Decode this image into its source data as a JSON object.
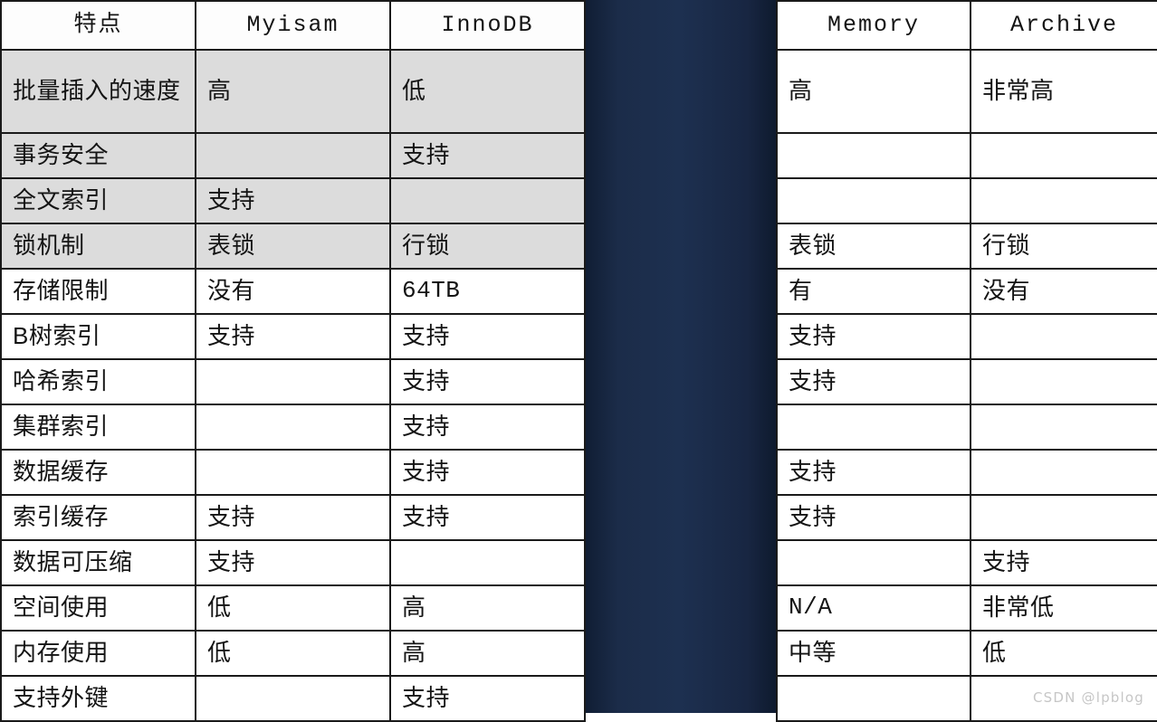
{
  "table_left": {
    "headers": [
      "特点",
      "Myisam",
      "InnoDB"
    ],
    "rows": [
      {
        "feature": "批量插入的速度",
        "myisam": "高",
        "innodb": "低"
      },
      {
        "feature": "事务安全",
        "myisam": "",
        "innodb": "支持"
      },
      {
        "feature": "全文索引",
        "myisam": "支持",
        "innodb": ""
      },
      {
        "feature": "锁机制",
        "myisam": "表锁",
        "innodb": "行锁"
      },
      {
        "feature": "存储限制",
        "myisam": "没有",
        "innodb": "64TB"
      },
      {
        "feature": "B树索引",
        "myisam": "支持",
        "innodb": "支持"
      },
      {
        "feature": "哈希索引",
        "myisam": "",
        "innodb": "支持"
      },
      {
        "feature": "集群索引",
        "myisam": "",
        "innodb": "支持"
      },
      {
        "feature": "数据缓存",
        "myisam": "",
        "innodb": "支持"
      },
      {
        "feature": "索引缓存",
        "myisam": "支持",
        "innodb": "支持"
      },
      {
        "feature": "数据可压缩",
        "myisam": "支持",
        "innodb": ""
      },
      {
        "feature": "空间使用",
        "myisam": "低",
        "innodb": "高"
      },
      {
        "feature": "内存使用",
        "myisam": "低",
        "innodb": "高"
      },
      {
        "feature": "支持外键",
        "myisam": "",
        "innodb": "支持"
      }
    ]
  },
  "table_right": {
    "headers": [
      "Memory",
      "Archive"
    ],
    "rows": [
      {
        "memory": "高",
        "archive": "非常高"
      },
      {
        "memory": "",
        "archive": ""
      },
      {
        "memory": "",
        "archive": ""
      },
      {
        "memory": "表锁",
        "archive": "行锁"
      },
      {
        "memory": "有",
        "archive": "没有"
      },
      {
        "memory": "支持",
        "archive": ""
      },
      {
        "memory": "支持",
        "archive": ""
      },
      {
        "memory": "",
        "archive": ""
      },
      {
        "memory": "支持",
        "archive": ""
      },
      {
        "memory": "支持",
        "archive": ""
      },
      {
        "memory": "",
        "archive": "支持"
      },
      {
        "memory": "N/A",
        "archive": "非常低"
      },
      {
        "memory": "中等",
        "archive": "低"
      },
      {
        "memory": "",
        "archive": ""
      }
    ]
  },
  "watermark": {
    "text": "CSDN @lpblog"
  },
  "colors": {
    "divider_navy": "#17263f",
    "shaded_row": "#dcdcdc",
    "cell_border": "#1a1a1a",
    "text": "#141414",
    "watermark": "#c6c6c6"
  }
}
